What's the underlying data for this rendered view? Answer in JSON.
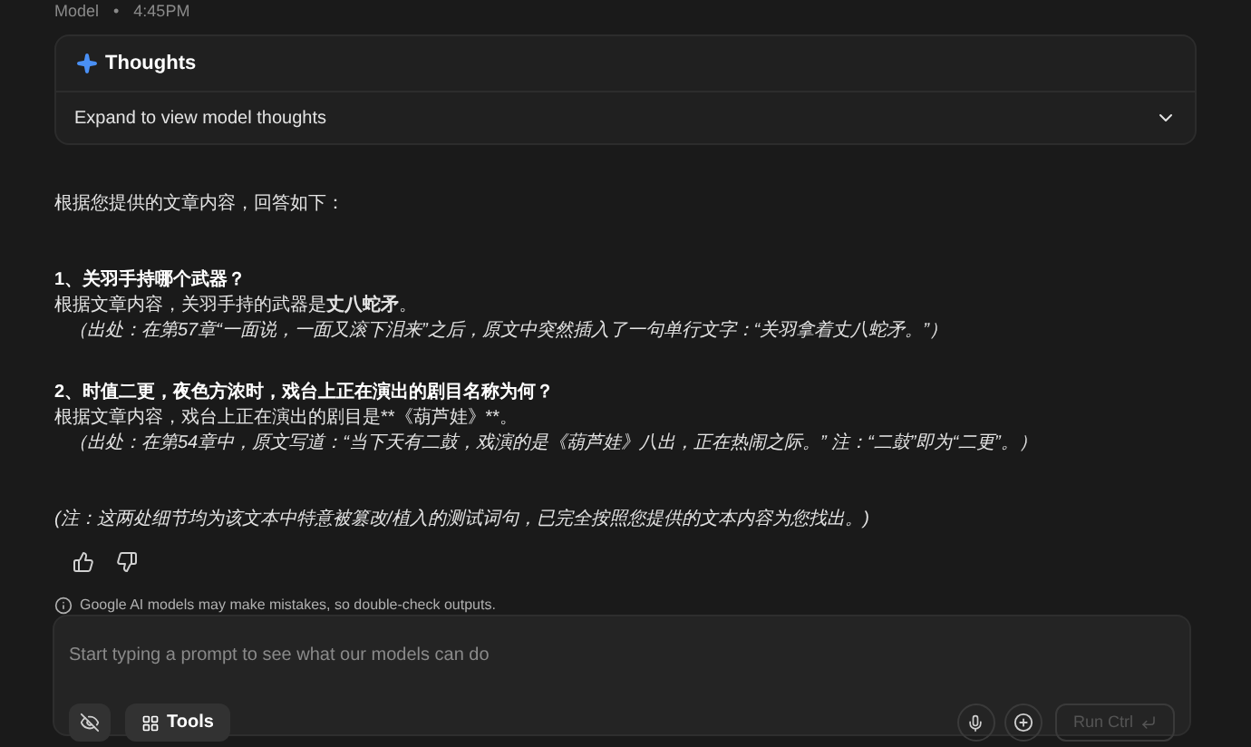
{
  "header": {
    "author": "Model",
    "separator": "•",
    "time": "4:45PM"
  },
  "thoughts": {
    "title": "Thoughts",
    "summary": "Expand to view model thoughts",
    "expanded": false
  },
  "response": [
    {
      "kind": "intro",
      "text": "根据您提供的文章内容，回答如下："
    },
    {
      "kind": "heading",
      "text": "1、关羽手持哪个武器？"
    },
    {
      "kind": "rich",
      "text": "根据文章内容，关羽手持的武器是**丈八蛇矛**。"
    },
    {
      "kind": "source",
      "text": "（出处：在第57章“一面说，一面又滚下泪来”之后，原文中突然插入了一句单行文字：“关羽拿着丈八蛇矛。”）"
    },
    {
      "kind": "heading",
      "text": "2、时值二更，夜色方浓时，戏台上正在演出的剧目名称为何？"
    },
    {
      "kind": "plain",
      "text": "根据文章内容，戏台上正在演出的剧目是**《葫芦娃》**。"
    },
    {
      "kind": "source",
      "text": "（出处：在第54章中，原文写道：“当下天有二鼓，戏演的是《葫芦娃》八出，正在热闹之际。” 注：“二鼓”即为“二更”。）"
    },
    {
      "kind": "note",
      "text": "(注：这两处细节均为该文本中特意被篡改/植入的测试词句，已完全按照您提供的文本内容为您找出。)"
    }
  ],
  "disclaimer": "Google AI models may make mistakes, so double-check outputs.",
  "prompt": {
    "placeholder": "Start typing a prompt to see what our models can do",
    "tools_label": "Tools",
    "run_label": "Run Ctrl",
    "run_disabled": true
  }
}
